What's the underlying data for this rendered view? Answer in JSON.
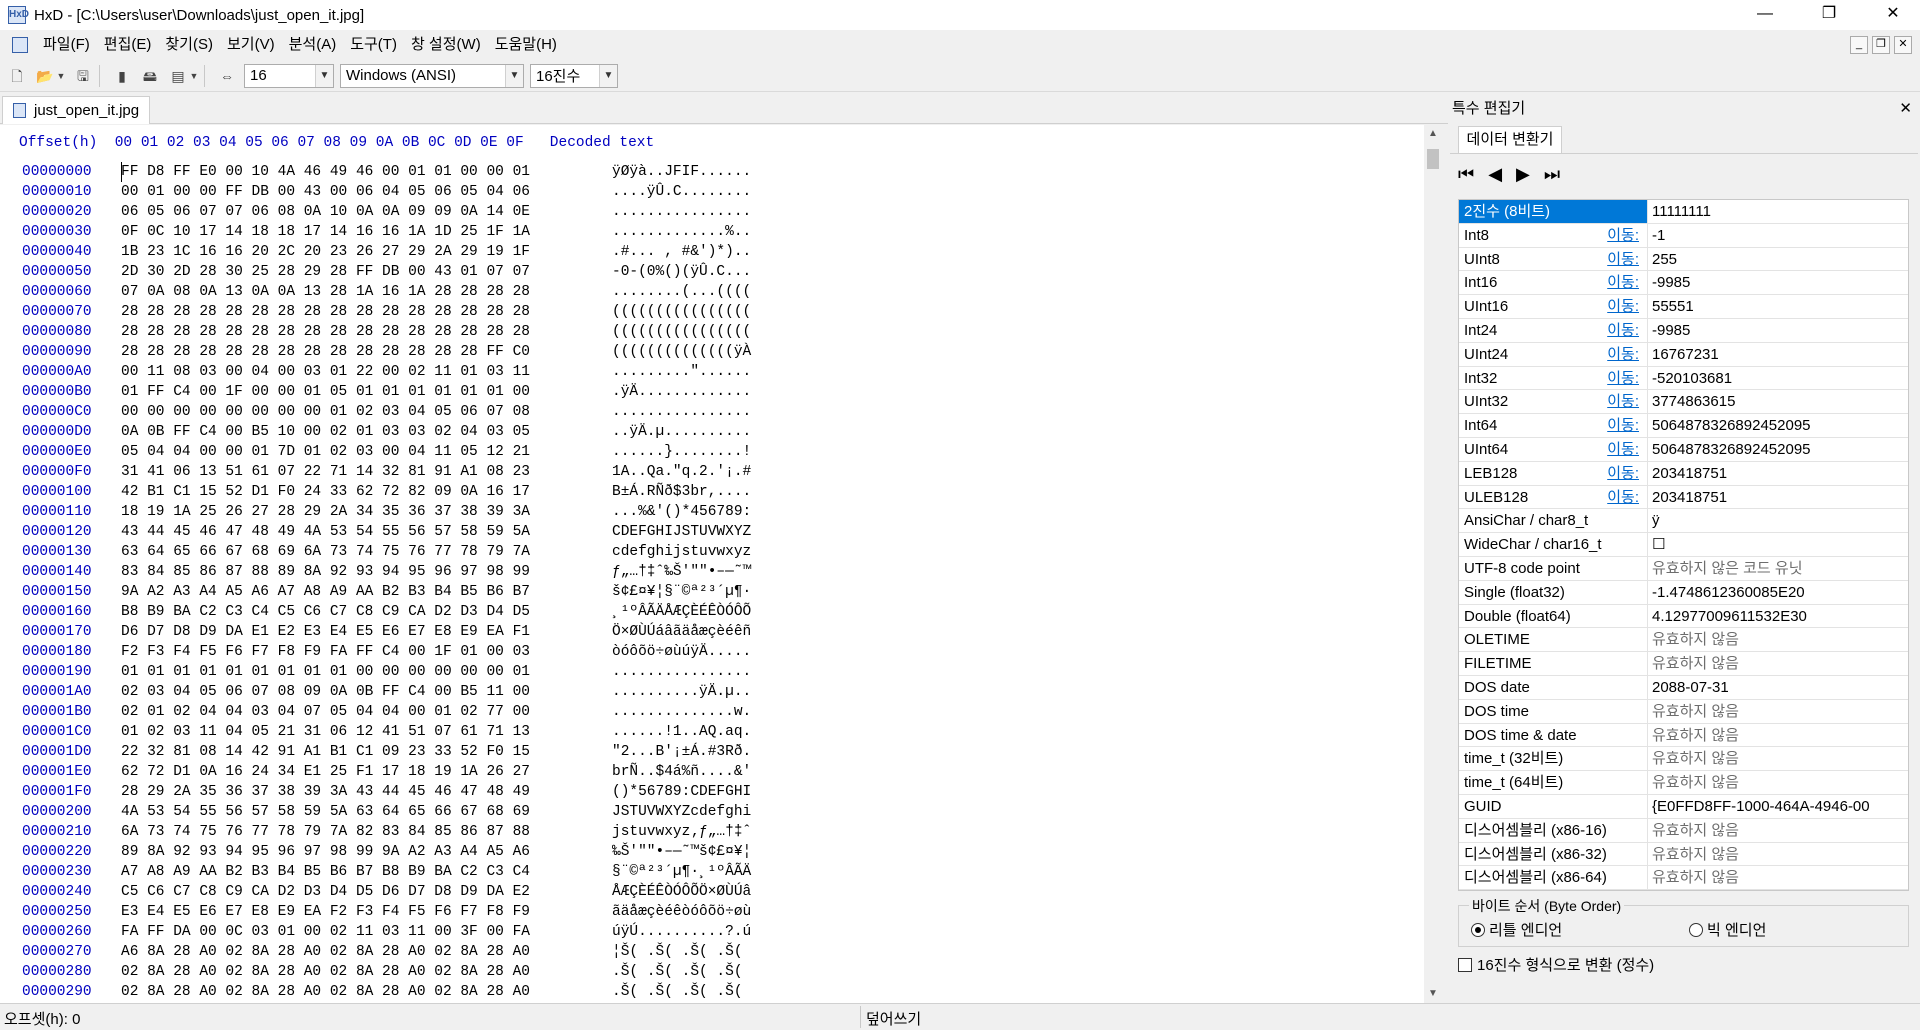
{
  "window": {
    "title": "HxD - [C:\\Users\\user\\Downloads\\just_open_it.jpg]",
    "min": "—",
    "max": "❐",
    "close": "✕"
  },
  "menu": [
    "파일(F)",
    "편집(E)",
    "찾기(S)",
    "보기(V)",
    "분석(A)",
    "도구(T)",
    "창 설정(W)",
    "도움말(H)"
  ],
  "toolbar": {
    "bytes_per_row": "16",
    "charset": "Windows (ANSI)",
    "offset_base": "16진수"
  },
  "doc_tab": "just_open_it.jpg",
  "hex": {
    "header": "Offset(h)  00 01 02 03 04 05 06 07 08 09 0A 0B 0C 0D 0E 0F   Decoded text",
    "rows": [
      {
        "o": "00000000",
        "h": "FF D8 FF E0 00 10 4A 46 49 46 00 01 01 00 00 01",
        "t": "ÿØÿà..JFIF......"
      },
      {
        "o": "00000010",
        "h": "00 01 00 00 FF DB 00 43 00 06 04 05 06 05 04 06",
        "t": "....ÿÛ.C........"
      },
      {
        "o": "00000020",
        "h": "06 05 06 07 07 06 08 0A 10 0A 0A 09 09 0A 14 0E",
        "t": "................"
      },
      {
        "o": "00000030",
        "h": "0F 0C 10 17 14 18 18 17 14 16 16 1A 1D 25 1F 1A",
        "t": ".............%.."
      },
      {
        "o": "00000040",
        "h": "1B 23 1C 16 16 20 2C 20 23 26 27 29 2A 29 19 1F",
        "t": ".#... , #&')*).."
      },
      {
        "o": "00000050",
        "h": "2D 30 2D 28 30 25 28 29 28 FF DB 00 43 01 07 07",
        "t": "-0-(0%()(ÿÛ.C..."
      },
      {
        "o": "00000060",
        "h": "07 0A 08 0A 13 0A 0A 13 28 1A 16 1A 28 28 28 28",
        "t": "........(...(((("
      },
      {
        "o": "00000070",
        "h": "28 28 28 28 28 28 28 28 28 28 28 28 28 28 28 28",
        "t": "(((((((((((((((("
      },
      {
        "o": "00000080",
        "h": "28 28 28 28 28 28 28 28 28 28 28 28 28 28 28 28",
        "t": "(((((((((((((((("
      },
      {
        "o": "00000090",
        "h": "28 28 28 28 28 28 28 28 28 28 28 28 28 28 FF C0",
        "t": "((((((((((((((ÿÀ"
      },
      {
        "o": "000000A0",
        "h": "00 11 08 03 00 04 00 03 01 22 00 02 11 01 03 11",
        "t": ".........\"......"
      },
      {
        "o": "000000B0",
        "h": "01 FF C4 00 1F 00 00 01 05 01 01 01 01 01 01 00",
        "t": ".ÿÄ............."
      },
      {
        "o": "000000C0",
        "h": "00 00 00 00 00 00 00 00 01 02 03 04 05 06 07 08",
        "t": "................"
      },
      {
        "o": "000000D0",
        "h": "0A 0B FF C4 00 B5 10 00 02 01 03 03 02 04 03 05",
        "t": "..ÿÄ.µ.........."
      },
      {
        "o": "000000E0",
        "h": "05 04 04 00 00 01 7D 01 02 03 00 04 11 05 12 21",
        "t": "......}........!"
      },
      {
        "o": "000000F0",
        "h": "31 41 06 13 51 61 07 22 71 14 32 81 91 A1 08 23",
        "t": "1A..Qa.\"q.2.'¡.#"
      },
      {
        "o": "00000100",
        "h": "42 B1 C1 15 52 D1 F0 24 33 62 72 82 09 0A 16 17",
        "t": "B±Á.RÑð$3br,...."
      },
      {
        "o": "00000110",
        "h": "18 19 1A 25 26 27 28 29 2A 34 35 36 37 38 39 3A",
        "t": "...%&'()*456789:"
      },
      {
        "o": "00000120",
        "h": "43 44 45 46 47 48 49 4A 53 54 55 56 57 58 59 5A",
        "t": "CDEFGHIJSTUVWXYZ"
      },
      {
        "o": "00000130",
        "h": "63 64 65 66 67 68 69 6A 73 74 75 76 77 78 79 7A",
        "t": "cdefghijstuvwxyz"
      },
      {
        "o": "00000140",
        "h": "83 84 85 86 87 88 89 8A 92 93 94 95 96 97 98 99",
        "t": "ƒ„…†‡ˆ‰Š'\"\"•–—˜™"
      },
      {
        "o": "00000150",
        "h": "9A A2 A3 A4 A5 A6 A7 A8 A9 AA B2 B3 B4 B5 B6 B7",
        "t": "š¢£¤¥¦§¨©ª²³´µ¶·"
      },
      {
        "o": "00000160",
        "h": "B8 B9 BA C2 C3 C4 C5 C6 C7 C8 C9 CA D2 D3 D4 D5",
        "t": "¸¹ºÂÃÄÅÆÇÈÉÊÒÓÔÕ"
      },
      {
        "o": "00000170",
        "h": "D6 D7 D8 D9 DA E1 E2 E3 E4 E5 E6 E7 E8 E9 EA F1",
        "t": "Ö×ØÙÚáâãäåæçèéêñ"
      },
      {
        "o": "00000180",
        "h": "F2 F3 F4 F5 F6 F7 F8 F9 FA FF C4 00 1F 01 00 03",
        "t": "òóôõö÷øùúÿÄ....."
      },
      {
        "o": "00000190",
        "h": "01 01 01 01 01 01 01 01 01 00 00 00 00 00 00 01",
        "t": "................"
      },
      {
        "o": "000001A0",
        "h": "02 03 04 05 06 07 08 09 0A 0B FF C4 00 B5 11 00",
        "t": "..........ÿÄ.µ.."
      },
      {
        "o": "000001B0",
        "h": "02 01 02 04 04 03 04 07 05 04 04 00 01 02 77 00",
        "t": "..............w."
      },
      {
        "o": "000001C0",
        "h": "01 02 03 11 04 05 21 31 06 12 41 51 07 61 71 13",
        "t": "......!1..AQ.aq."
      },
      {
        "o": "000001D0",
        "h": "22 32 81 08 14 42 91 A1 B1 C1 09 23 33 52 F0 15",
        "t": "\"2...B'¡±Á.#3Rð."
      },
      {
        "o": "000001E0",
        "h": "62 72 D1 0A 16 24 34 E1 25 F1 17 18 19 1A 26 27",
        "t": "brÑ..$4á%ñ....&'"
      },
      {
        "o": "000001F0",
        "h": "28 29 2A 35 36 37 38 39 3A 43 44 45 46 47 48 49",
        "t": "()*56789:CDEFGHI"
      },
      {
        "o": "00000200",
        "h": "4A 53 54 55 56 57 58 59 5A 63 64 65 66 67 68 69",
        "t": "JSTUVWXYZcdefghi"
      },
      {
        "o": "00000210",
        "h": "6A 73 74 75 76 77 78 79 7A 82 83 84 85 86 87 88",
        "t": "jstuvwxyz‚ƒ„…†‡ˆ"
      },
      {
        "o": "00000220",
        "h": "89 8A 92 93 94 95 96 97 98 99 9A A2 A3 A4 A5 A6",
        "t": "‰Š'\"\"•–—˜™š¢£¤¥¦"
      },
      {
        "o": "00000230",
        "h": "A7 A8 A9 AA B2 B3 B4 B5 B6 B7 B8 B9 BA C2 C3 C4",
        "t": "§¨©ª²³´µ¶·¸¹ºÂÃÄ"
      },
      {
        "o": "00000240",
        "h": "C5 C6 C7 C8 C9 CA D2 D3 D4 D5 D6 D7 D8 D9 DA E2",
        "t": "ÅÆÇÈÉÊÒÓÔÕÖ×ØÙÚâ"
      },
      {
        "o": "00000250",
        "h": "E3 E4 E5 E6 E7 E8 E9 EA F2 F3 F4 F5 F6 F7 F8 F9",
        "t": "ãäåæçèéêòóôõö÷øù"
      },
      {
        "o": "00000260",
        "h": "FA FF DA 00 0C 03 01 00 02 11 03 11 00 3F 00 FA",
        "t": "úÿÚ..........?.ú"
      },
      {
        "o": "00000270",
        "h": "A6 8A 28 A0 02 8A 28 A0 02 8A 28 A0 02 8A 28 A0",
        "t": "¦Š( .Š( .Š( .Š( "
      },
      {
        "o": "00000280",
        "h": "02 8A 28 A0 02 8A 28 A0 02 8A 28 A0 02 8A 28 A0",
        ".t": "",
        "t": ".Š( .Š( .Š( .Š( "
      },
      {
        "o": "00000290",
        "h": "02 8A 28 A0 02 8A 28 A0 02 8A 28 A0 02 8A 28 A0",
        "t": ".Š( .Š( .Š( .Š( "
      }
    ]
  },
  "status": {
    "offset": "오프셋(h): 0",
    "mode": "덮어쓰기"
  },
  "side": {
    "title": "특수 편집기",
    "close": "✕",
    "tab": "데이터 변환기",
    "go_label": "이동:",
    "rows": [
      {
        "n": "2진수 (8비트)",
        "v": "11111111",
        "go": false,
        "sel": true
      },
      {
        "n": "Int8",
        "v": "-1",
        "go": true
      },
      {
        "n": "UInt8",
        "v": "255",
        "go": true
      },
      {
        "n": "Int16",
        "v": "-9985",
        "go": true
      },
      {
        "n": "UInt16",
        "v": "55551",
        "go": true
      },
      {
        "n": "Int24",
        "v": "-9985",
        "go": true
      },
      {
        "n": "UInt24",
        "v": "16767231",
        "go": true
      },
      {
        "n": "Int32",
        "v": "-520103681",
        "go": true
      },
      {
        "n": "UInt32",
        "v": "3774863615",
        "go": true
      },
      {
        "n": "Int64",
        "v": "5064878326892452095",
        "go": true
      },
      {
        "n": "UInt64",
        "v": "5064878326892452095",
        "go": true
      },
      {
        "n": "LEB128",
        "v": "203418751",
        "go": true
      },
      {
        "n": "ULEB128",
        "v": "203418751",
        "go": true
      },
      {
        "n": "AnsiChar / char8_t",
        "v": "ÿ",
        "go": false
      },
      {
        "n": "WideChar / char16_t",
        "v": "☐",
        "go": false
      },
      {
        "n": "UTF-8 code point",
        "v": "유효하지 않은 코드 유닛",
        "go": false,
        "gray": true
      },
      {
        "n": "Single (float32)",
        "v": "-1.4748612360085E20",
        "go": false
      },
      {
        "n": "Double (float64)",
        "v": "4.12977009611532E30",
        "go": false
      },
      {
        "n": "OLETIME",
        "v": "유효하지 않음",
        "go": false,
        "gray": true
      },
      {
        "n": "FILETIME",
        "v": "유효하지 않음",
        "go": false,
        "gray": true
      },
      {
        "n": "DOS date",
        "v": "2088-07-31",
        "go": false
      },
      {
        "n": "DOS time",
        "v": "유효하지 않음",
        "go": false,
        "gray": true
      },
      {
        "n": "DOS time & date",
        "v": "유효하지 않음",
        "go": false,
        "gray": true
      },
      {
        "n": "time_t (32비트)",
        "v": "유효하지 않음",
        "go": false,
        "gray": true
      },
      {
        "n": "time_t (64비트)",
        "v": "유효하지 않음",
        "go": false,
        "gray": true
      },
      {
        "n": "GUID",
        "v": "{E0FFD8FF-1000-464A-4946-00",
        "go": false
      },
      {
        "n": "디스어셈블리 (x86-16)",
        "v": "유효하지 않음",
        "go": false,
        "gray": true
      },
      {
        "n": "디스어셈블리 (x86-32)",
        "v": "유효하지 않음",
        "go": false,
        "gray": true
      },
      {
        "n": "디스어셈블리 (x86-64)",
        "v": "유효하지 않음",
        "go": false,
        "gray": true
      }
    ],
    "byte_order_label": "바이트 순서 (Byte Order)",
    "little_endian": "리틀 엔디언",
    "big_endian": "빅 엔디언",
    "hex_check": "16진수 형식으로 변환 (정수)"
  }
}
